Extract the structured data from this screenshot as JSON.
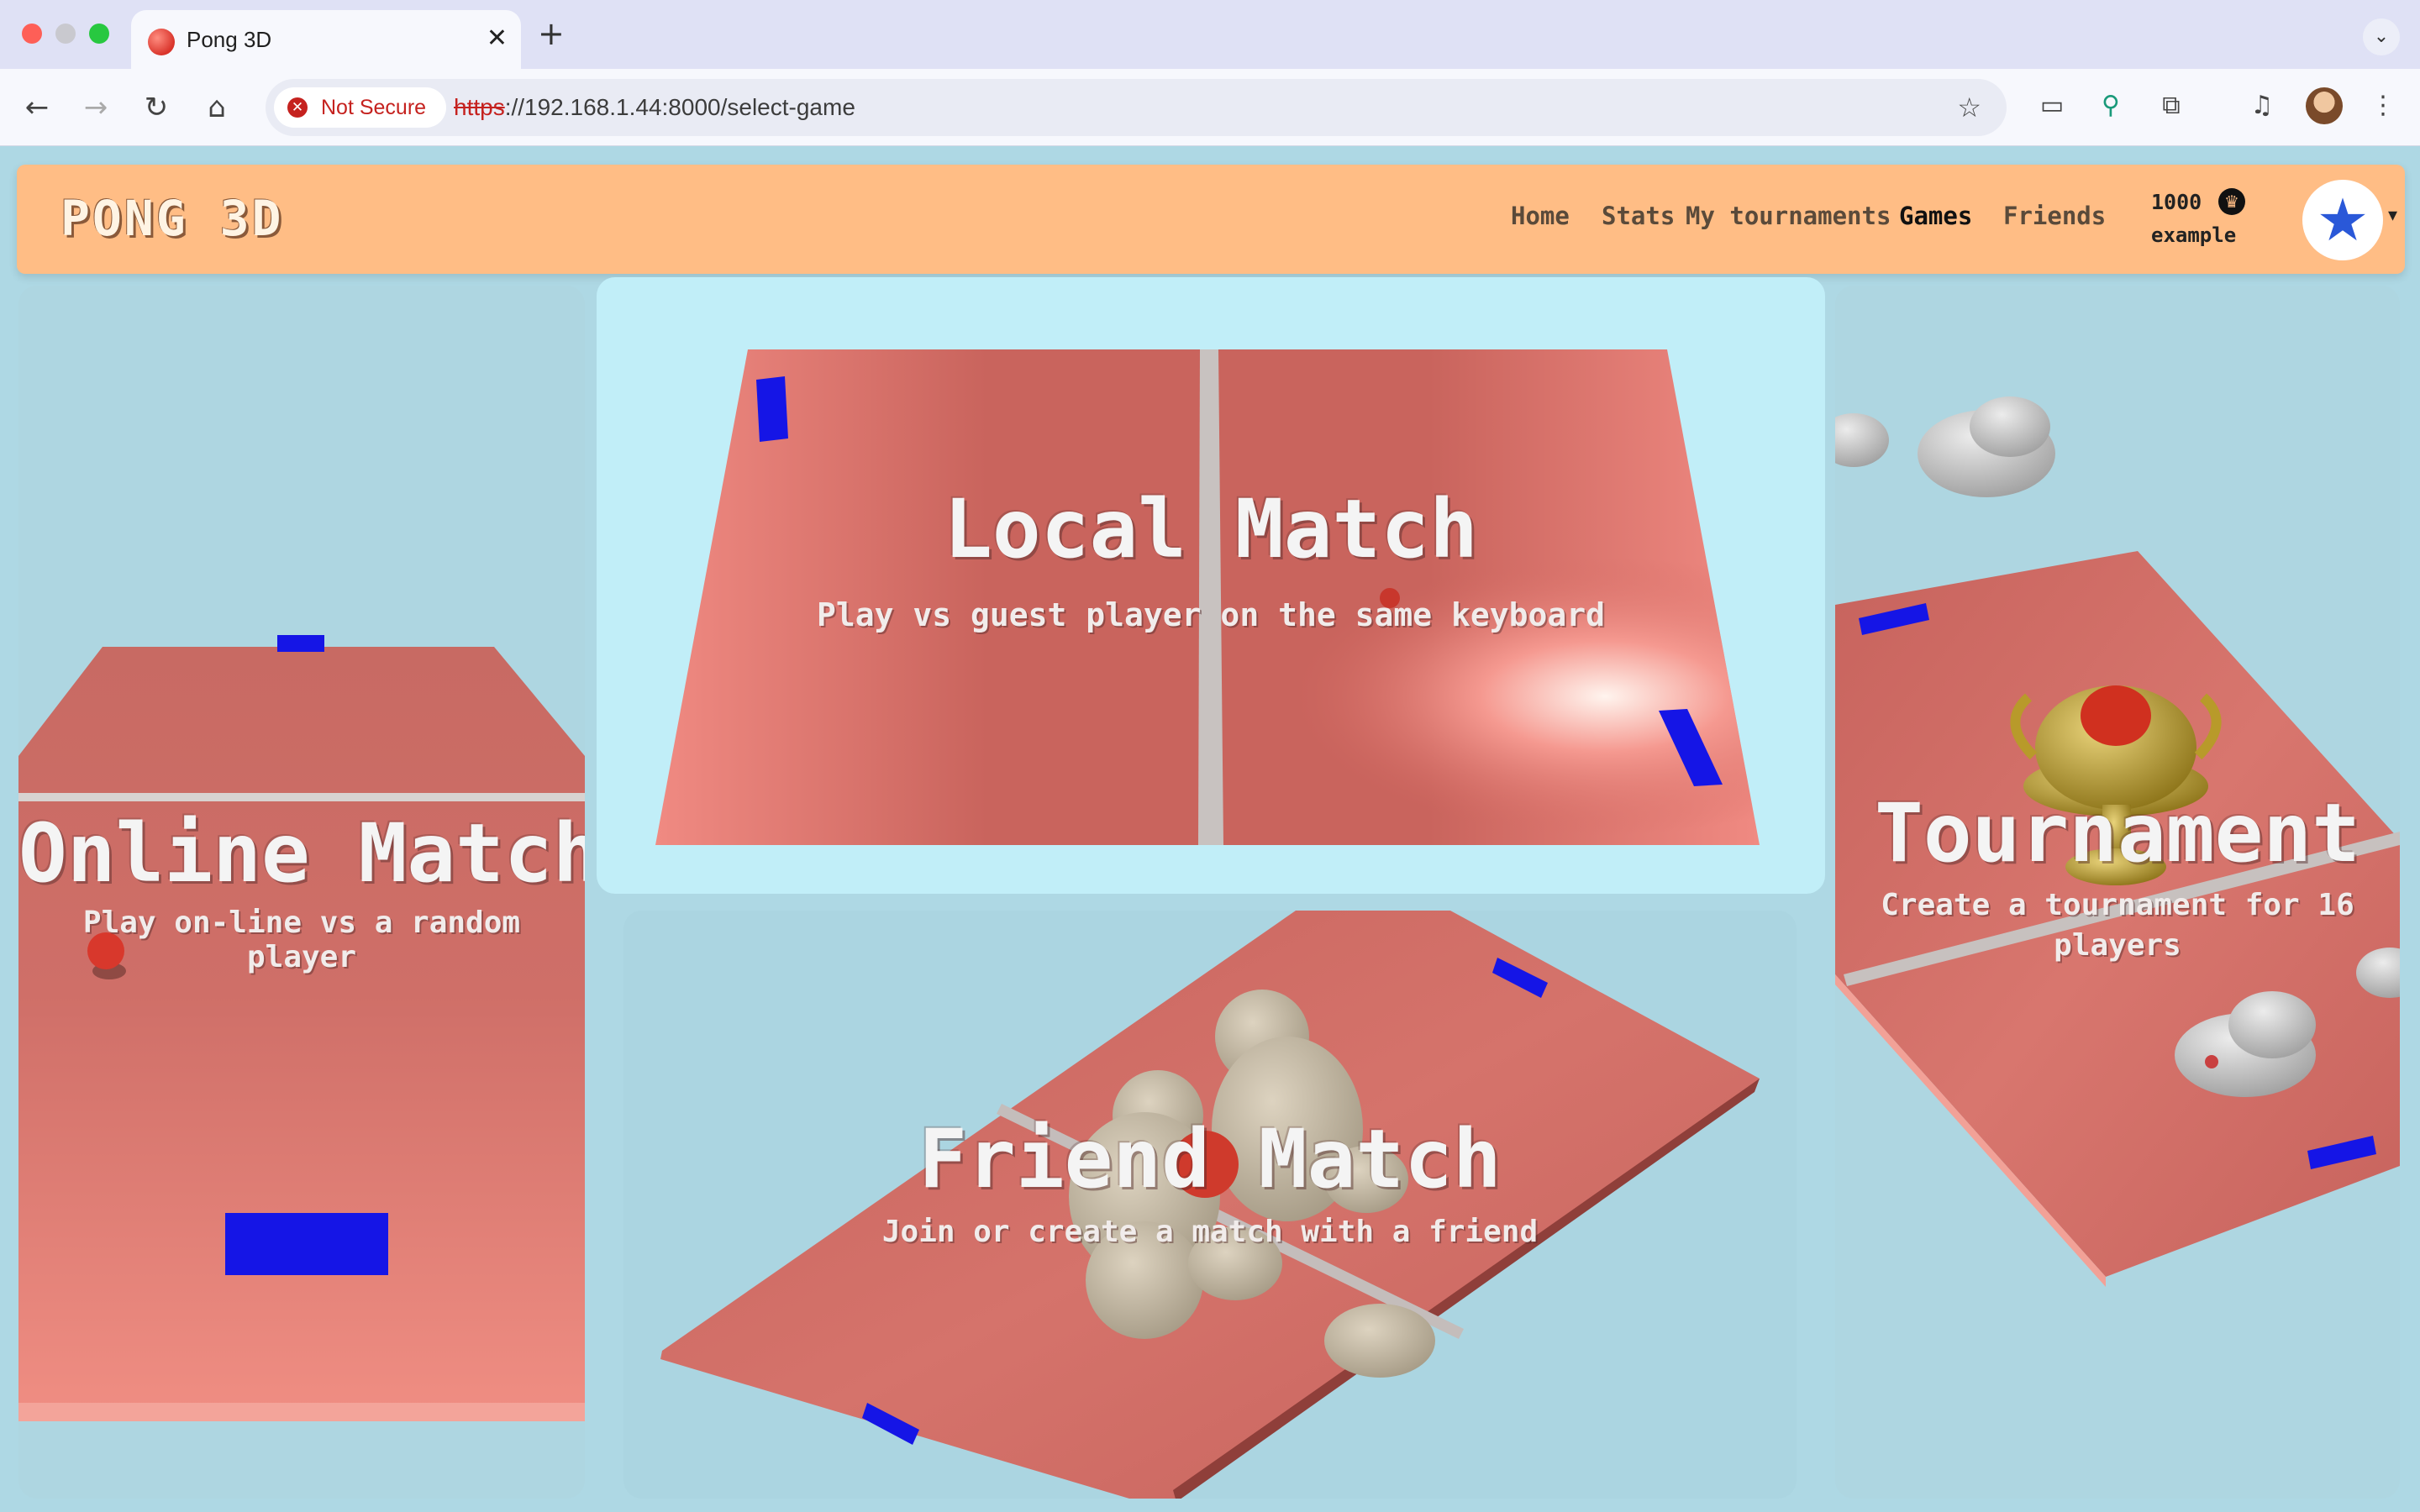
{
  "browser": {
    "tab_title": "Pong 3D",
    "tab_close": "✕",
    "new_tab": "+",
    "security_label": "Not Secure",
    "url_scheme": "https",
    "url_rest": "://192.168.1.44:8000/select-game"
  },
  "navbar": {
    "logo": "PONG 3D",
    "links": [
      "Home",
      "Stats",
      "My tournaments",
      "Games",
      "Friends"
    ],
    "active_link": "Games",
    "coins": "1000",
    "username": "example"
  },
  "games": {
    "online": {
      "title": "Online Match",
      "subtitle": "Play on-line vs a random player"
    },
    "local": {
      "title": "Local Match",
      "subtitle": "Play vs guest player on the same keyboard"
    },
    "friend": {
      "title": "Friend Match",
      "subtitle": "Join or create a match with a friend"
    },
    "tournament": {
      "title": "Tournament",
      "subtitle": "Create a tournament for 16 players"
    }
  },
  "colors": {
    "navbar": "#ffbd85",
    "table": "#d9706a",
    "paddle": "#1515e6",
    "page_bg": "#aed8e4"
  }
}
